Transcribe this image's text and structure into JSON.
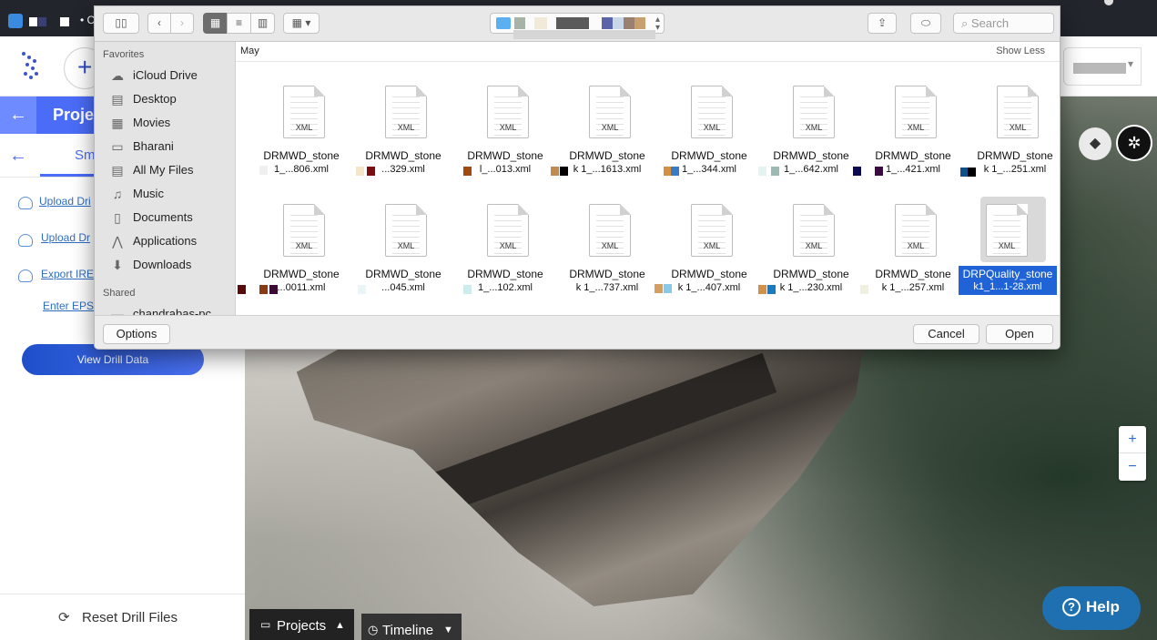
{
  "browser": {
    "tab_title": "• C"
  },
  "sidebar": {
    "project_header": "Proje",
    "sub_tab": "Sm",
    "links": [
      "Upload Dri",
      "Upload Dr",
      "Export IRE",
      "Enter EPS"
    ],
    "view_button": "View Drill Data",
    "reset": "Reset Drill Files"
  },
  "map": {
    "zoom_in": "+",
    "zoom_out": "−",
    "help": "Help",
    "bottom_tabs": [
      "Projects",
      "Timeline"
    ]
  },
  "dialog": {
    "search_placeholder": "Search",
    "group_label": "May",
    "show_less": "Show Less",
    "sidebar_sections": {
      "favorites": "Favorites",
      "shared": "Shared"
    },
    "favorites": [
      {
        "label": "iCloud Drive",
        "icon": "cloud-icon"
      },
      {
        "label": "Desktop",
        "icon": "desktop-icon"
      },
      {
        "label": "Movies",
        "icon": "movies-icon"
      },
      {
        "label": "Bharani",
        "icon": "folder-icon"
      },
      {
        "label": "All My Files",
        "icon": "all-files-icon"
      },
      {
        "label": "Music",
        "icon": "music-icon"
      },
      {
        "label": "Documents",
        "icon": "documents-icon"
      },
      {
        "label": "Applications",
        "icon": "applications-icon"
      },
      {
        "label": "Downloads",
        "icon": "downloads-icon"
      }
    ],
    "shared": [
      {
        "label": "chandrabas-pc",
        "icon": "computer-icon"
      }
    ],
    "files": [
      {
        "name1": "DRMWD_stone",
        "name2": "1_...806.xml",
        "selected": false
      },
      {
        "name1": "DRMWD_stone",
        "name2": "...329.xml",
        "selected": false
      },
      {
        "name1": "DRMWD_stone",
        "name2": "l_...013.xml",
        "selected": false
      },
      {
        "name1": "DRMWD_stone",
        "name2": "k 1_...1613.xml",
        "selected": false
      },
      {
        "name1": "DRMWD_stone",
        "name2": "1_...344.xml",
        "selected": false
      },
      {
        "name1": "DRMWD_stone",
        "name2": "1_...642.xml",
        "selected": false
      },
      {
        "name1": "DRMWD_stone",
        "name2": "1_...421.xml",
        "selected": false
      },
      {
        "name1": "DRMWD_stone",
        "name2": "k 1_...251.xml",
        "selected": false
      },
      {
        "name1": "DRMWD_stone",
        "name2": "...0011.xml",
        "selected": false
      },
      {
        "name1": "DRMWD_stone",
        "name2": "...045.xml",
        "selected": false
      },
      {
        "name1": "DRMWD_stone",
        "name2": "1_...102.xml",
        "selected": false
      },
      {
        "name1": "DRMWD_stone",
        "name2": "k 1_...737.xml",
        "selected": false
      },
      {
        "name1": "DRMWD_stone",
        "name2": "k 1_...407.xml",
        "selected": false
      },
      {
        "name1": "DRMWD_stone",
        "name2": "k 1_...230.xml",
        "selected": false
      },
      {
        "name1": "DRMWD_stone",
        "name2": "k 1_...257.xml",
        "selected": false
      },
      {
        "name1": "DRPQuality_stone",
        "name2": "k1_1...1-28.xml",
        "selected": true
      }
    ],
    "file_type_label": "XML",
    "options": "Options",
    "cancel": "Cancel",
    "open": "Open"
  }
}
